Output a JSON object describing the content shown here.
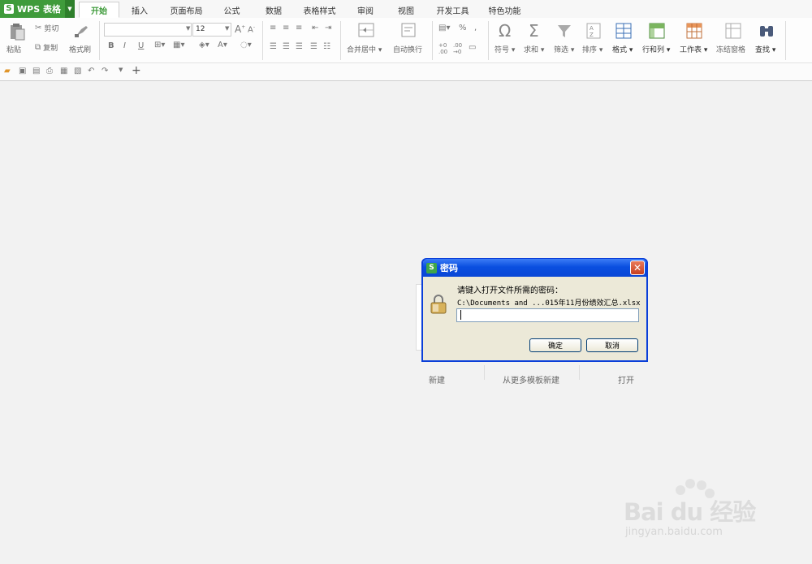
{
  "app": {
    "name": "WPS 表格"
  },
  "tabs": [
    "开始",
    "插入",
    "页面布局",
    "公式",
    "数据",
    "表格样式",
    "审阅",
    "视图",
    "开发工具",
    "特色功能"
  ],
  "ribbon": {
    "paste": "粘贴",
    "cut": "剪切",
    "copy": "复制",
    "format_painter": "格式刷",
    "font_size": "12",
    "merge_center": "合并居中",
    "wrap_text": "自动换行",
    "percent": "%",
    "symbol": "符号",
    "sum": "求和",
    "filter": "筛选",
    "sort": "排序",
    "format": "格式",
    "row_col": "行和列",
    "worksheet": "工作表",
    "freeze": "冻结窗格",
    "find": "查找"
  },
  "start_page": {
    "new": "新建",
    "from_template": "从更多模板新建",
    "open": "打开"
  },
  "dialog": {
    "title": "密码",
    "prompt": "请键入打开文件所需的密码：",
    "path": "C:\\Documents and ...015年11月份绩效汇总.xlsx",
    "password_value": "",
    "ok": "确定",
    "cancel": "取消"
  },
  "watermark": {
    "brand": "Bai du 经验",
    "url": "jingyan.baidu.com"
  }
}
